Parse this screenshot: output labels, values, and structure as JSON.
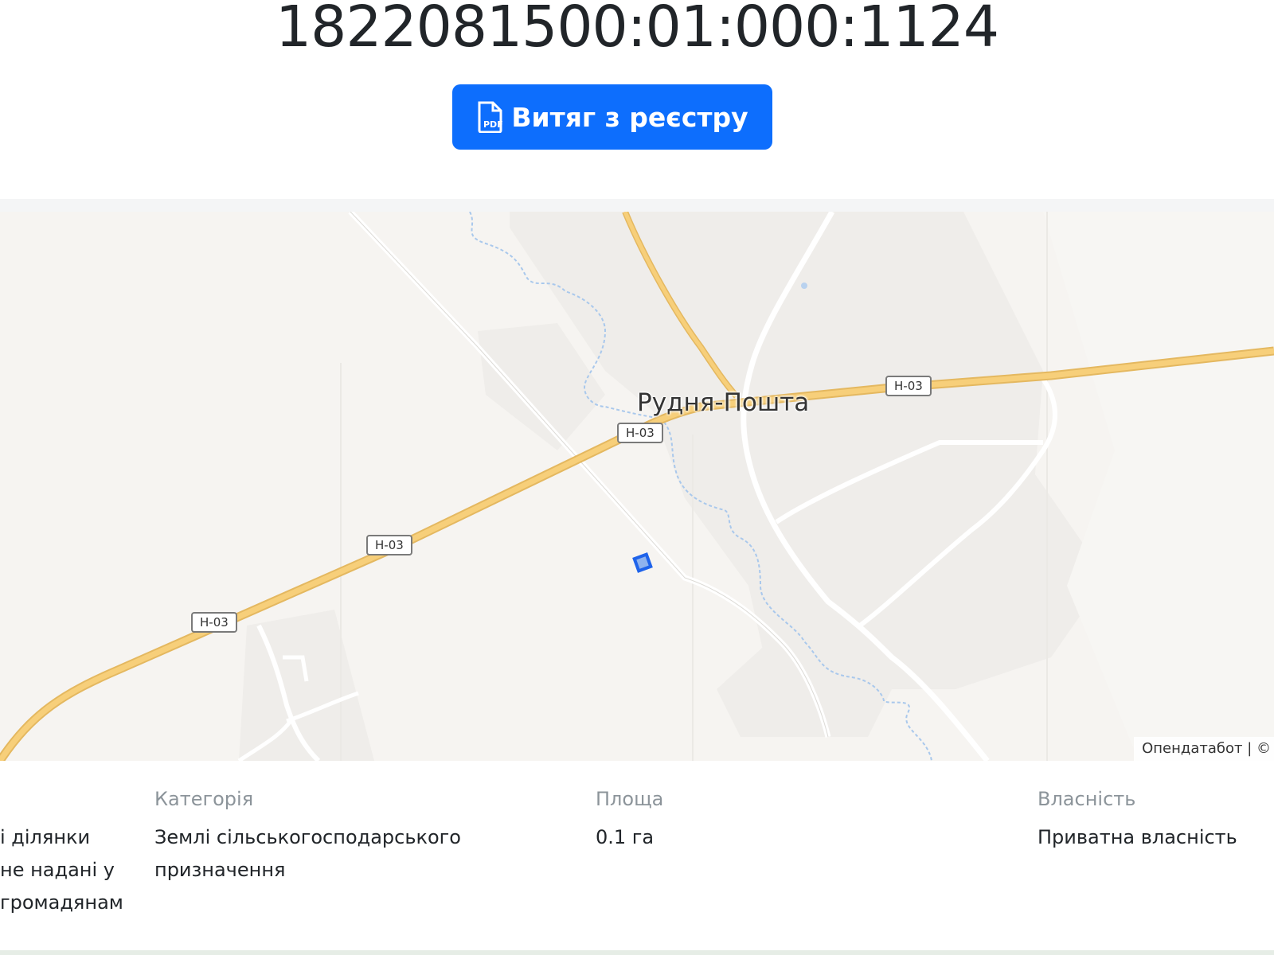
{
  "header": {
    "cadastral_number": "1822081500:01:000:1124",
    "extract_button_label": "Витяг з реєстру",
    "extract_button_icon": "file-pdf-icon"
  },
  "map": {
    "place_name": "Рудня-Пошта",
    "road_shields": [
      "Н-03",
      "Н-03",
      "Н-03",
      "Н-03"
    ],
    "attribution": "Опендатабот | ©",
    "colors": {
      "background": "#f6f4f1",
      "main_road": "#f7cf7a",
      "stream": "#a9c8ec",
      "parcel_fill": "#8fb3ee",
      "parcel_border": "#1f63ea"
    }
  },
  "details": {
    "first_column_lines": [
      "і ділянки",
      "не надані у",
      "громадянам"
    ],
    "category_label": "Категорія",
    "category_lines": [
      "Землі сільськогосподарського",
      "призначення"
    ],
    "area_label": "Площа",
    "area_value": "0.1 га",
    "ownership_label": "Власність",
    "ownership_value": "Приватна власність"
  },
  "colors": {
    "primary_button": "#0d6efd",
    "muted_label": "#8c949a"
  }
}
